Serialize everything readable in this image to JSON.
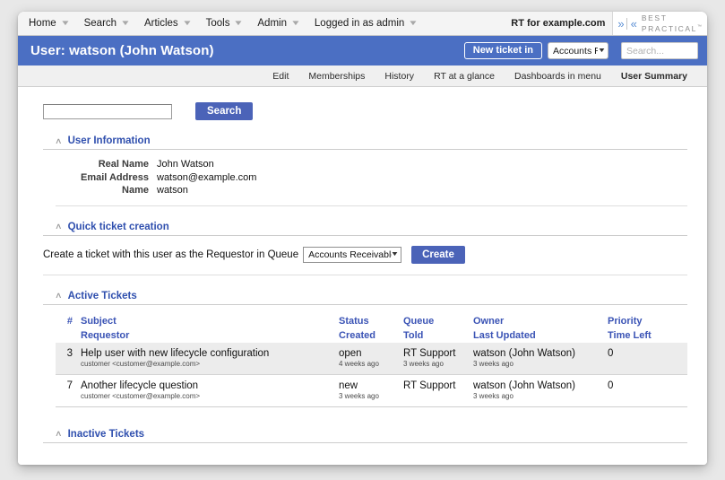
{
  "topnav": {
    "items": [
      {
        "label": "Home",
        "has_caret": true
      },
      {
        "label": "Search",
        "has_caret": true
      },
      {
        "label": "Articles",
        "has_caret": true
      },
      {
        "label": "Tools",
        "has_caret": true
      },
      {
        "label": "Admin",
        "has_caret": true
      },
      {
        "label": "Logged in as admin",
        "has_caret": true
      }
    ],
    "instance_label": "RT for example.com",
    "logo": {
      "chevron_right": "»",
      "chevron_left": "«",
      "line1": "BEST",
      "line2": "PRACTICAL",
      "tm": "™"
    }
  },
  "titlebar": {
    "title": "User: watson (John Watson)",
    "new_ticket_label": "New ticket in",
    "queue_value": "Accounts Re",
    "search_placeholder": "Search...",
    "search_value": "",
    "bg_color": "#4b6fc3"
  },
  "pagetabs": [
    {
      "label": "Edit",
      "active": false
    },
    {
      "label": "Memberships",
      "active": false
    },
    {
      "label": "History",
      "active": false
    },
    {
      "label": "RT at a glance",
      "active": false
    },
    {
      "label": "Dashboards in menu",
      "active": false
    },
    {
      "label": "User Summary",
      "active": true
    }
  ],
  "search_row": {
    "input_value": "",
    "input_placeholder": "",
    "button_label": "Search"
  },
  "user_information": {
    "title": "User Information",
    "collapse_icon": "∧",
    "rows": [
      {
        "label": "Real Name",
        "value": "John Watson"
      },
      {
        "label": "Email Address",
        "value": "watson@example.com"
      },
      {
        "label": "Name",
        "value": "watson"
      }
    ]
  },
  "quick_ticket": {
    "title": "Quick ticket creation",
    "collapse_icon": "∧",
    "label": "Create a ticket with this user as the Requestor in Queue",
    "queue_value": "Accounts Receivable",
    "create_label": "Create"
  },
  "active_tickets": {
    "title": "Active Tickets",
    "collapse_icon": "∧",
    "headers_row1": [
      "#",
      "Subject",
      "Status",
      "Queue",
      "Owner",
      "Priority"
    ],
    "headers_row2": [
      "",
      "Requestor",
      "Created",
      "Told",
      "Last Updated",
      "Time Left"
    ],
    "rows": [
      {
        "id": "3",
        "subject": "Help user with new lifecycle configuration",
        "requestor": "customer <customer@example.com>",
        "status": "open",
        "created": "4 weeks ago",
        "queue": "RT Support",
        "told": "3 weeks ago",
        "owner": "watson (John Watson)",
        "last_updated": "3 weeks ago",
        "priority": "0",
        "time_left": "",
        "shaded": true
      },
      {
        "id": "7",
        "subject": "Another lifecycle question",
        "requestor": "customer <customer@example.com>",
        "status": "new",
        "created": "3 weeks ago",
        "queue": "RT Support",
        "told": "",
        "owner": "watson (John Watson)",
        "last_updated": "3 weeks ago",
        "priority": "0",
        "time_left": "",
        "shaded": false
      }
    ]
  },
  "inactive_tickets": {
    "title": "Inactive Tickets",
    "collapse_icon": "∧"
  }
}
